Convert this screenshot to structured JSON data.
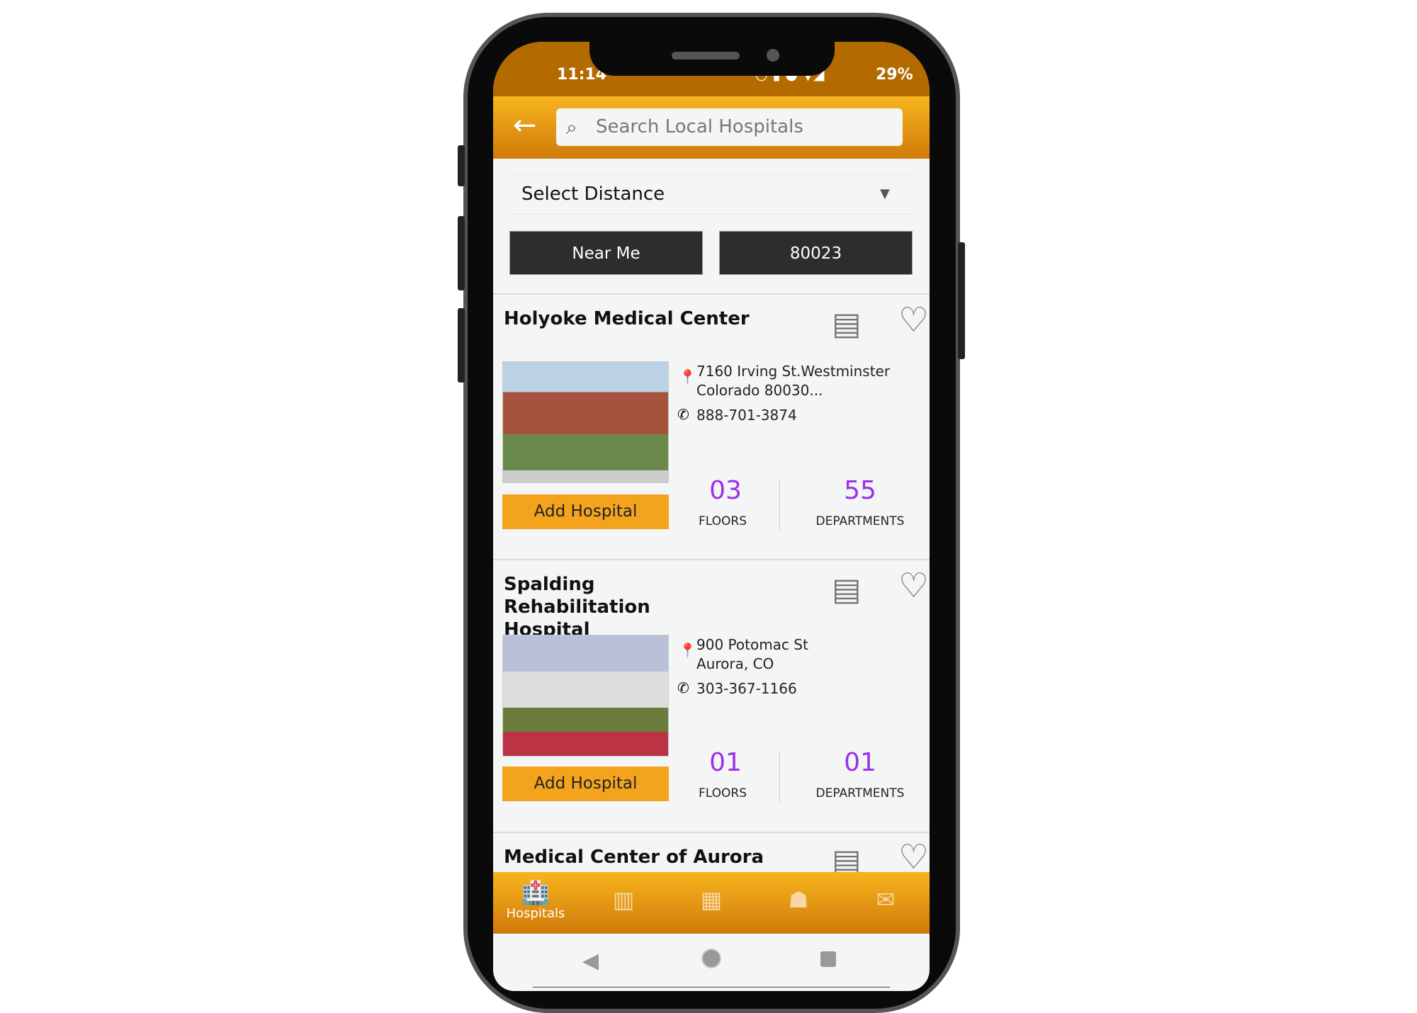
{
  "status": {
    "time": "11:14",
    "battery": "29%"
  },
  "header": {
    "search_placeholder": "Search Local Hospitals"
  },
  "filters": {
    "distance_label": "Select Distance",
    "near_me": "Near Me",
    "zip": "80023"
  },
  "hospitals": [
    {
      "name": "Holyoke Medical Center",
      "address1": "7160 Irving St.Westminster",
      "address2": "Colorado 80030...",
      "phone": "888-701-3874",
      "floors": "03",
      "floors_label": "FLOORS",
      "departments": "55",
      "departments_label": "DEPARTMENTS",
      "add_label": "Add Hospital"
    },
    {
      "name": "Spalding Rehabilitation Hospital",
      "address1": "900 Potomac St",
      "address2": "Aurora, CO",
      "phone": "303-367-1166",
      "floors": "01",
      "floors_label": "FLOORS",
      "departments": "01",
      "departments_label": "DEPARTMENTS",
      "add_label": "Add Hospital"
    },
    {
      "name": "Medical Center of Aurora"
    }
  ],
  "bottom_nav": {
    "active_label": "Hospitals",
    "items": [
      "hospitals-icon",
      "library-icon",
      "dashboard-icon",
      "group-icon",
      "mail-icon"
    ]
  },
  "colors": {
    "accent": "#f3a41c",
    "status_bar": "#b36b00",
    "stat_number": "#9b30e8"
  }
}
